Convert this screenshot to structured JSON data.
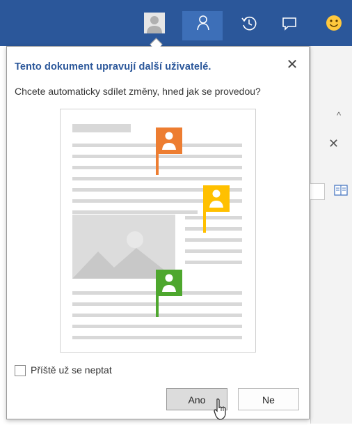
{
  "titlebar": {
    "background": "#2b579a",
    "icons": [
      "user-avatar-icon",
      "share-person-icon",
      "history-icon",
      "comments-icon",
      "smiley-icon"
    ]
  },
  "dialog": {
    "title": "Tento dokument upravují další uživatelé.",
    "close_label": "✕",
    "question": "Chcete automaticky sdílet změny, hned jak se provedou?",
    "flag_colors": [
      "#ed7d31",
      "#ffc000",
      "#4ea72e"
    ],
    "checkbox": {
      "label": "Příště už se neptat",
      "checked": false
    },
    "buttons": {
      "yes_label": "Ano",
      "no_label": "Ne"
    }
  },
  "right_pane": {
    "collapse_label": "^",
    "close_label": "✕"
  }
}
